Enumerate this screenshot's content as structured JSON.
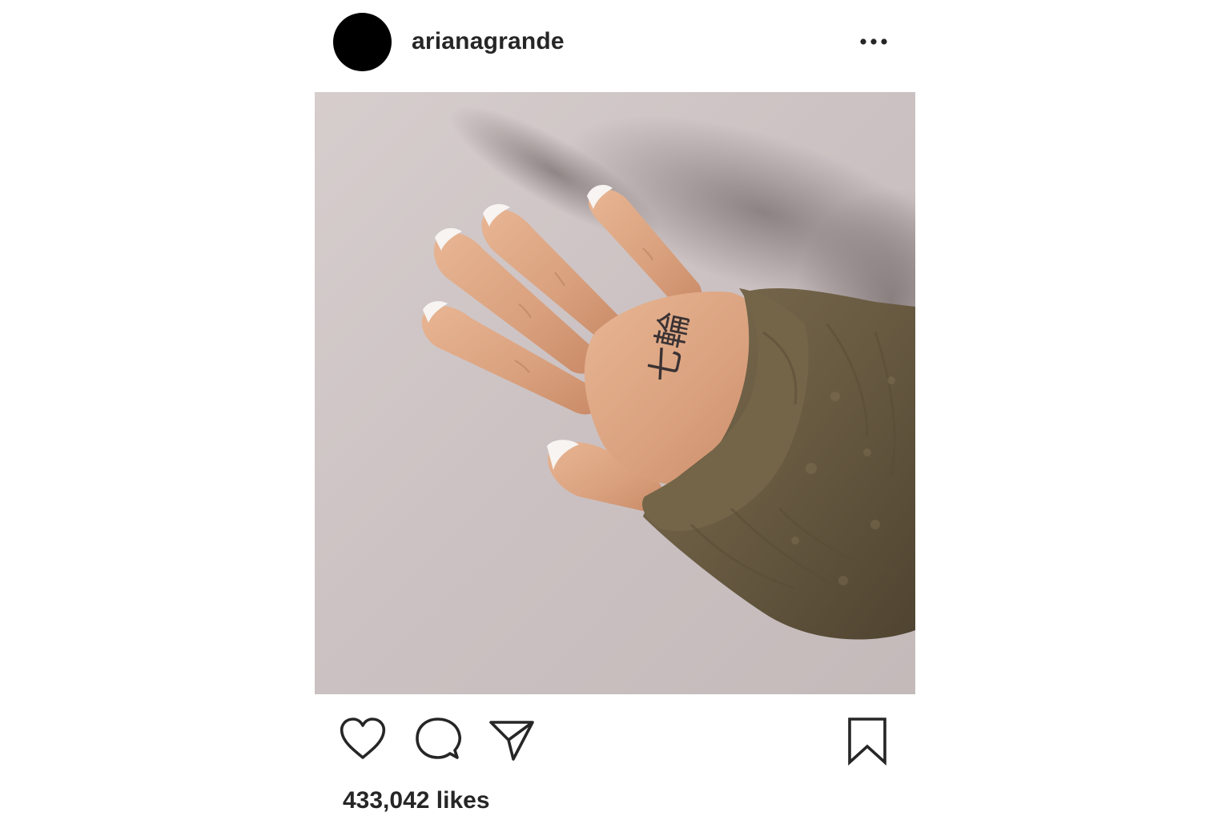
{
  "post": {
    "username": "arianagrande",
    "likes_text": "433,042 likes",
    "photo": {
      "description_icon": "photo",
      "tattoo_text": "七輪"
    }
  },
  "icons": {
    "more": "more-horizontal-icon",
    "like": "heart-icon",
    "comment": "comment-icon",
    "share": "paper-plane-icon",
    "save": "bookmark-icon"
  },
  "colors": {
    "text": "#262626",
    "avatar": "#000000",
    "icon_stroke": "#262626"
  }
}
